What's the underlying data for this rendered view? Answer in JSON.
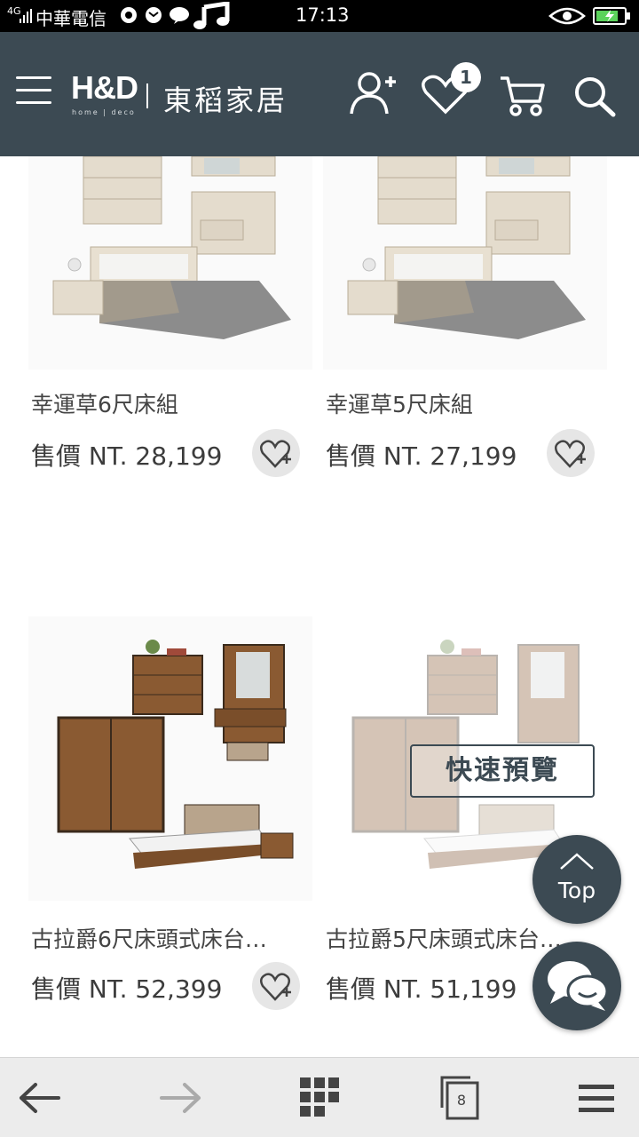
{
  "status_bar": {
    "signal": "4G",
    "carrier": "中華電信",
    "time": "17:13"
  },
  "header": {
    "logo": "H&D",
    "logo_sub": "home | deco",
    "brand": "東稻家居",
    "wishlist_count": "1",
    "colors": {
      "background": "#3c4a53",
      "text": "#ffffff"
    },
    "icons": [
      "menu-icon",
      "user-add-icon",
      "heart-icon",
      "cart-icon",
      "search-icon"
    ]
  },
  "products": [
    {
      "name": "幸運草6尺床組",
      "price": "售價 NT. 28,199"
    },
    {
      "name": "幸運草5尺床組",
      "price": "售價 NT. 27,199"
    },
    {
      "name": "古拉爵6尺床頭式床台…",
      "price": "售價 NT. 52,399"
    },
    {
      "name": "古拉爵5尺床頭式床台…",
      "price": "售價 NT. 51,199"
    }
  ],
  "overlay": {
    "quick_view": "快速預覽",
    "top_label": "Top"
  },
  "bottom_nav": {
    "tabs_count": "8",
    "icons": [
      "back-arrow-icon",
      "forward-arrow-icon",
      "apps-grid-icon",
      "tabs-icon",
      "hamburger-menu-icon"
    ]
  }
}
